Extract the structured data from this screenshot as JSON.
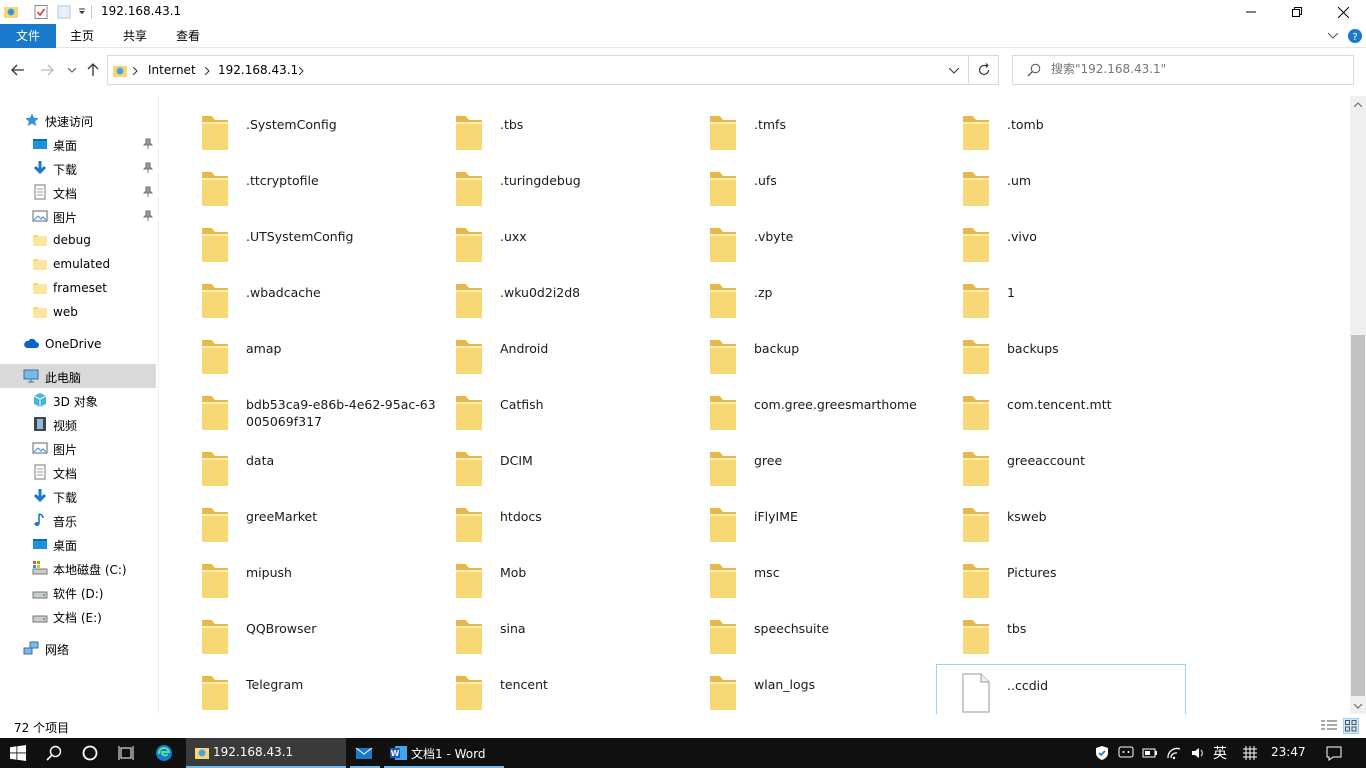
{
  "window": {
    "title": "192.168.43.1"
  },
  "ribbon": {
    "tabs": [
      "文件",
      "主页",
      "共享",
      "查看"
    ]
  },
  "address": {
    "parts": [
      "Internet",
      "192.168.43.1"
    ]
  },
  "search": {
    "placeholder": "搜索\"192.168.43.1\""
  },
  "navpane": {
    "quick_access": "快速访问",
    "quick_items": [
      "桌面",
      "下载",
      "文档",
      "图片",
      "debug",
      "emulated",
      "frameset",
      "web"
    ],
    "onedrive": "OneDrive",
    "this_pc": "此电脑",
    "pc_items": [
      "3D 对象",
      "视频",
      "图片",
      "文档",
      "下载",
      "音乐",
      "桌面",
      "本地磁盘 (C:)",
      "软件 (D:)",
      "文档 (E:)"
    ],
    "network": "网络"
  },
  "items": [
    ".SystemConfig",
    ".tbs",
    ".tmfs",
    ".tomb",
    ".ttcryptofile",
    ".turingdebug",
    ".ufs",
    ".um",
    ".UTSystemConfig",
    ".uxx",
    ".vbyte",
    ".vivo",
    ".wbadcache",
    ".wku0d2i2d8",
    ".zp",
    "1",
    "amap",
    "Android",
    "backup",
    "backups",
    "bdb53ca9-e86b-4e62-95ac-63005069f317",
    "Catfish",
    "com.gree.greesmarthome",
    "com.tencent.mtt",
    "data",
    "DCIM",
    "gree",
    "greeaccount",
    "greeMarket",
    "htdocs",
    "iFlyIME",
    "ksweb",
    "mipush",
    "Mob",
    "msc",
    "Pictures",
    "QQBrowser",
    "sina",
    "speechsuite",
    "tbs",
    "Telegram",
    "tencent",
    "wlan_logs",
    "..ccdid"
  ],
  "selected_item": "..ccdid",
  "status": {
    "count": "72 个项目"
  },
  "taskbar": {
    "apps": [
      {
        "label": "192.168.43.1",
        "icon": "explorer-ftp-icon",
        "active": true
      },
      {
        "label": "",
        "icon": "mail-icon",
        "active": false
      },
      {
        "label": "文档1 - Word",
        "icon": "word-icon",
        "active": false
      }
    ],
    "ime": "英",
    "clock": "23:47"
  },
  "colors": {
    "accent": "#1979ca",
    "folder": "#f8d775",
    "folder_dark": "#e8b84a",
    "selection": "#99d1ff"
  }
}
